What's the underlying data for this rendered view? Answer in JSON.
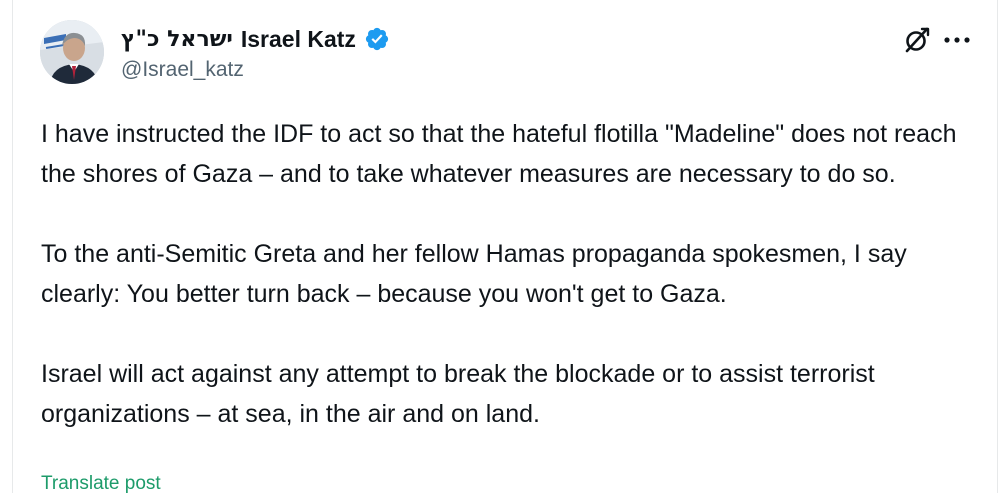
{
  "author": {
    "name_hebrew": "ישראל כ\"ץ",
    "name_english": "Israel Katz",
    "handle": "@Israel_katz",
    "verified": true,
    "verified_color": "#1d9bf0"
  },
  "header_actions": {
    "grok_icon": "grok-icon",
    "more_icon": "more-icon"
  },
  "post": {
    "text": "I have instructed the IDF to act so that the hateful flotilla \"Madeline\" does not reach the shores of Gaza – and to take whatever measures are necessary to do so.\n\nTo the anti-Semitic Greta and her fellow Hamas propaganda spokesmen, I say clearly: You better turn back – because you won't get to Gaza.\n\nIsrael will act against any attempt to break the blockade or to assist terrorist organizations – at sea, in the air and on land."
  },
  "translate_label": "Translate post",
  "colors": {
    "text": "#0f1419",
    "muted": "#536471",
    "translate": "#1d9b6a",
    "border": "#e7e9ea"
  }
}
